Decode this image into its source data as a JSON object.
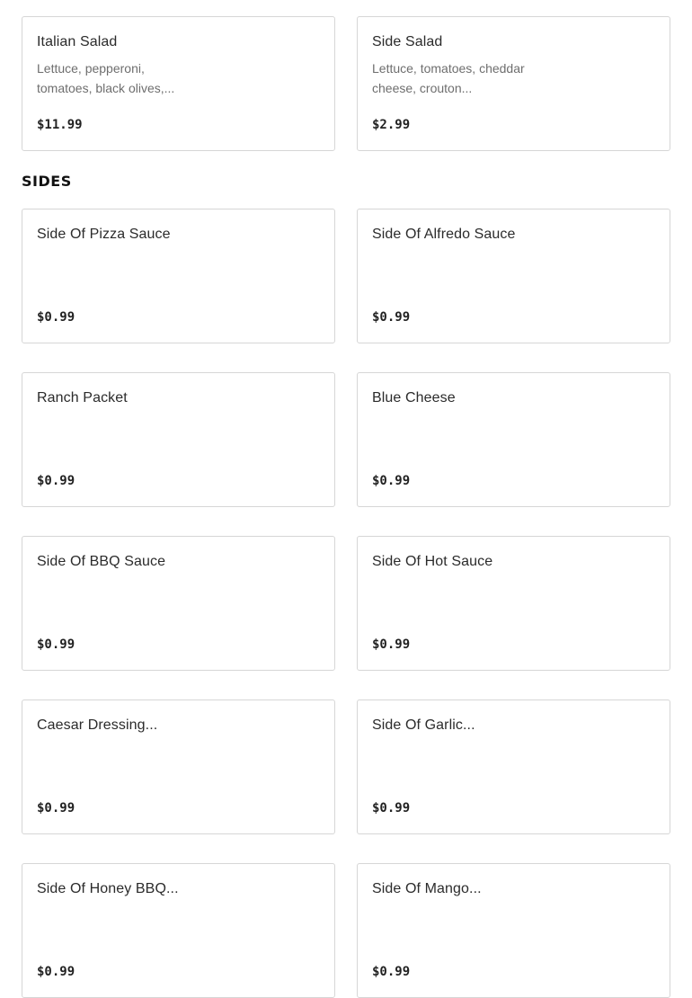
{
  "salads": {
    "items": [
      {
        "name": "Italian Salad",
        "description": "Lettuce, pepperoni, tomatoes, black olives,...",
        "price": "$11.99"
      },
      {
        "name": "Side Salad",
        "description": "Lettuce, tomatoes, cheddar cheese, crouton...",
        "price": "$2.99"
      }
    ]
  },
  "sides": {
    "heading": "SIDES",
    "items": [
      {
        "name": "Side Of Pizza Sauce",
        "price": "$0.99"
      },
      {
        "name": "Side Of Alfredo Sauce",
        "price": "$0.99"
      },
      {
        "name": "Ranch Packet",
        "price": "$0.99"
      },
      {
        "name": "Blue Cheese",
        "price": "$0.99"
      },
      {
        "name": "Side Of BBQ Sauce",
        "price": "$0.99"
      },
      {
        "name": "Side Of Hot Sauce",
        "price": "$0.99"
      },
      {
        "name": "Caesar Dressing...",
        "price": "$0.99"
      },
      {
        "name": "Side Of Garlic...",
        "price": "$0.99"
      },
      {
        "name": "Side Of Honey BBQ...",
        "price": "$0.99"
      },
      {
        "name": "Side Of Mango...",
        "price": "$0.99"
      }
    ]
  }
}
